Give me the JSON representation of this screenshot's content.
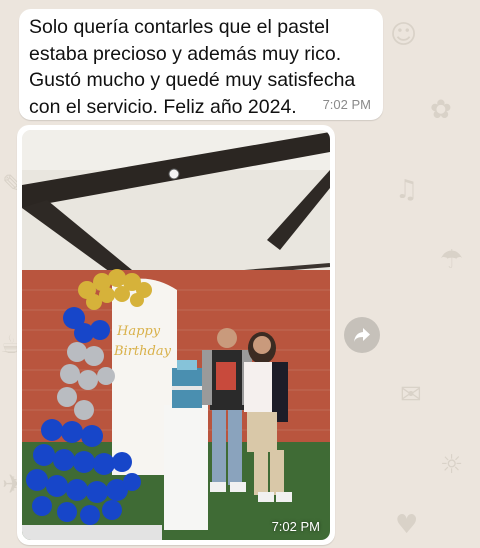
{
  "chat": {
    "messages": [
      {
        "type": "text",
        "text": "Solo quería contarles que el pastel estaba precioso y además muy rico. Gustó mucho y quedé muy satisfecha con el servicio. Feliz año 2024.",
        "time": "7:02 PM"
      },
      {
        "type": "photo",
        "photo_sign": "Happy Birthday",
        "time": "7:02 PM"
      }
    ],
    "forward_icon": "forward-arrow-icon"
  },
  "colors": {
    "wallpaper": "#ece5dd",
    "bubble": "#ffffff",
    "time_text": "#8a8a8a",
    "forward_button": "#c6c1ba"
  }
}
